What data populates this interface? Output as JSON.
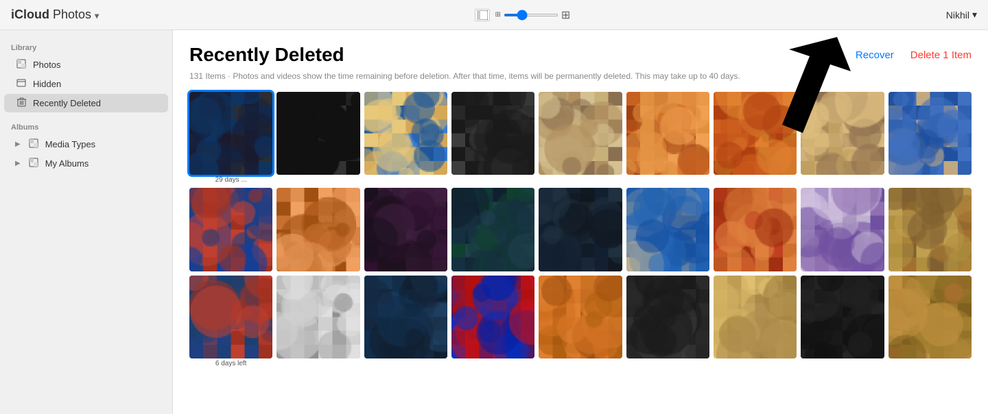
{
  "topbar": {
    "brand": "iCloud",
    "app": "Photos",
    "app_chevron": "▾",
    "user": "Nikhil",
    "user_chevron": "▾"
  },
  "sidebar": {
    "library_label": "Library",
    "library_items": [
      {
        "id": "photos",
        "label": "Photos",
        "icon": "▦"
      },
      {
        "id": "hidden",
        "label": "Hidden",
        "icon": "▨"
      },
      {
        "id": "recently-deleted",
        "label": "Recently Deleted",
        "icon": "🗑",
        "active": true
      }
    ],
    "albums_label": "Albums",
    "albums_items": [
      {
        "id": "media-types",
        "label": "Media Types",
        "icon": "▦",
        "expandable": true
      },
      {
        "id": "my-albums",
        "label": "My Albums",
        "icon": "▦",
        "expandable": true
      }
    ]
  },
  "content": {
    "title": "Recently Deleted",
    "subtitle": "131 Items  ·  Photos and videos show the time remaining before deletion. After that time, items will be permanently deleted. This may take up to 40 days.",
    "recover_label": "Recover",
    "delete_label": "Delete 1 Item"
  },
  "photos": {
    "rows": [
      {
        "cells": [
          {
            "id": "p1",
            "selected": true,
            "label": "29 days ...",
            "color1": "#1a1a2e",
            "color2": "#2d2d2d"
          },
          {
            "id": "p2",
            "selected": false,
            "label": "",
            "color1": "#1a1a1a",
            "color2": "#2a2a2a"
          },
          {
            "id": "p3",
            "selected": false,
            "label": "",
            "color1": "#2d5fa0",
            "color2": "#e8c87a"
          },
          {
            "id": "p4",
            "selected": false,
            "label": "",
            "color1": "#2a2a2a",
            "color2": "#3a3a3a"
          },
          {
            "id": "p5",
            "selected": false,
            "label": "",
            "color1": "#c8a870",
            "color2": "#8a7050"
          },
          {
            "id": "p6",
            "selected": false,
            "label": "",
            "color1": "#c87030",
            "color2": "#e0a050"
          },
          {
            "id": "p7",
            "selected": false,
            "label": "",
            "color1": "#c86020",
            "color2": "#d08030"
          },
          {
            "id": "p8",
            "selected": false,
            "label": "",
            "color1": "#c8a870",
            "color2": "#a08050"
          },
          {
            "id": "p9",
            "selected": false,
            "label": "",
            "color1": "#3060b0",
            "color2": "#c0a880"
          }
        ]
      },
      {
        "cells": [
          {
            "id": "p10",
            "selected": false,
            "label": "",
            "color1": "#2050a0",
            "color2": "#c04030"
          },
          {
            "id": "p11",
            "selected": false,
            "label": "",
            "color1": "#c86820",
            "color2": "#e09040"
          },
          {
            "id": "p12",
            "selected": false,
            "label": "",
            "color1": "#1a1a1a",
            "color2": "#502040"
          },
          {
            "id": "p13",
            "selected": false,
            "label": "",
            "color1": "#205040",
            "color2": "#304060"
          },
          {
            "id": "p14",
            "selected": false,
            "label": "",
            "color1": "#203040",
            "color2": "#101820"
          },
          {
            "id": "p15",
            "selected": false,
            "label": "",
            "color1": "#2050a0",
            "color2": "#d0c0a0"
          },
          {
            "id": "p16",
            "selected": false,
            "label": "",
            "color1": "#c05020",
            "color2": "#e08030"
          },
          {
            "id": "p17",
            "selected": false,
            "label": "",
            "color1": "#d0c0e0",
            "color2": "#8060a0"
          },
          {
            "id": "p18",
            "selected": false,
            "label": "",
            "color1": "#c0a050",
            "color2": "#806030"
          }
        ]
      },
      {
        "cells": [
          {
            "id": "p19",
            "selected": false,
            "label": "6 days left",
            "color1": "#205080",
            "color2": "#c04030"
          },
          {
            "id": "p20",
            "selected": false,
            "label": "",
            "color1": "#808080",
            "color2": "#e0e0e0"
          },
          {
            "id": "p21",
            "selected": false,
            "label": "",
            "color1": "#204060",
            "color2": "#102030"
          },
          {
            "id": "p22",
            "selected": false,
            "label": "",
            "color1": "#1040a0",
            "color2": "#c02020"
          },
          {
            "id": "p23",
            "selected": false,
            "label": "",
            "color1": "#e08020",
            "color2": "#a06010"
          },
          {
            "id": "p24",
            "selected": false,
            "label": "",
            "color1": "#202020",
            "color2": "#404040"
          },
          {
            "id": "p25",
            "selected": false,
            "label": "",
            "color1": "#e0c080",
            "color2": "#a08040"
          },
          {
            "id": "p26",
            "selected": false,
            "label": "",
            "color1": "#202020",
            "color2": "#303030"
          },
          {
            "id": "p27",
            "selected": false,
            "label": "",
            "color1": "#c09040",
            "color2": "#806020"
          }
        ]
      }
    ]
  }
}
